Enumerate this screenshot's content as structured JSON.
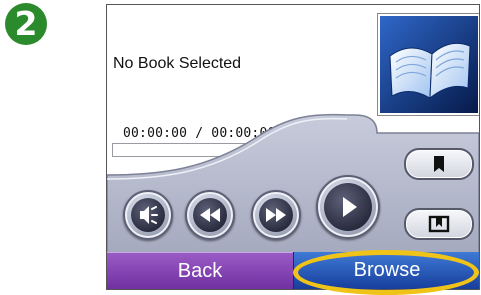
{
  "step": {
    "number": "2"
  },
  "book": {
    "status": "No Book Selected"
  },
  "playback": {
    "time": "00:00:00 / 00:00:00",
    "progress": 0
  },
  "controls": {
    "icons": [
      "volume-icon",
      "rewind-icon",
      "fast-forward-icon",
      "play-icon",
      "bookmark-icon",
      "chapters-icon"
    ]
  },
  "nav": {
    "back_label": "Back",
    "browse_label": "Browse"
  },
  "colors": {
    "step_badge": "#2b8a2b",
    "back_button": "#7a3aa8",
    "browse_button": "#1f4fb4",
    "highlight": "#f0c318",
    "panel": "#aeb3c6",
    "cover": "#0a2a6b"
  }
}
